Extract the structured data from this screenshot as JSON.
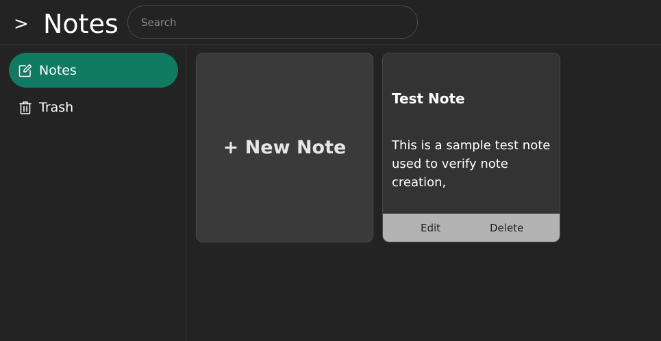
{
  "header": {
    "toggle_label": ">",
    "title": "Notes",
    "search_placeholder": "Search",
    "search_value": ""
  },
  "sidebar": {
    "items": [
      {
        "label": "Notes",
        "icon": "edit-note-icon",
        "active": true
      },
      {
        "label": "Trash",
        "icon": "trash-icon",
        "active": false
      }
    ]
  },
  "main": {
    "new_note_label": "+ New Note",
    "notes": [
      {
        "title": "Test Note",
        "body": "This is a sample test note used to verify note creation,",
        "edit_label": "Edit",
        "delete_label": "Delete"
      }
    ]
  },
  "colors": {
    "accent": "#117a62",
    "background": "#232323",
    "card": "#333333",
    "new_note_card": "#3a3a3a",
    "actions_bar": "#b3b3b3"
  }
}
